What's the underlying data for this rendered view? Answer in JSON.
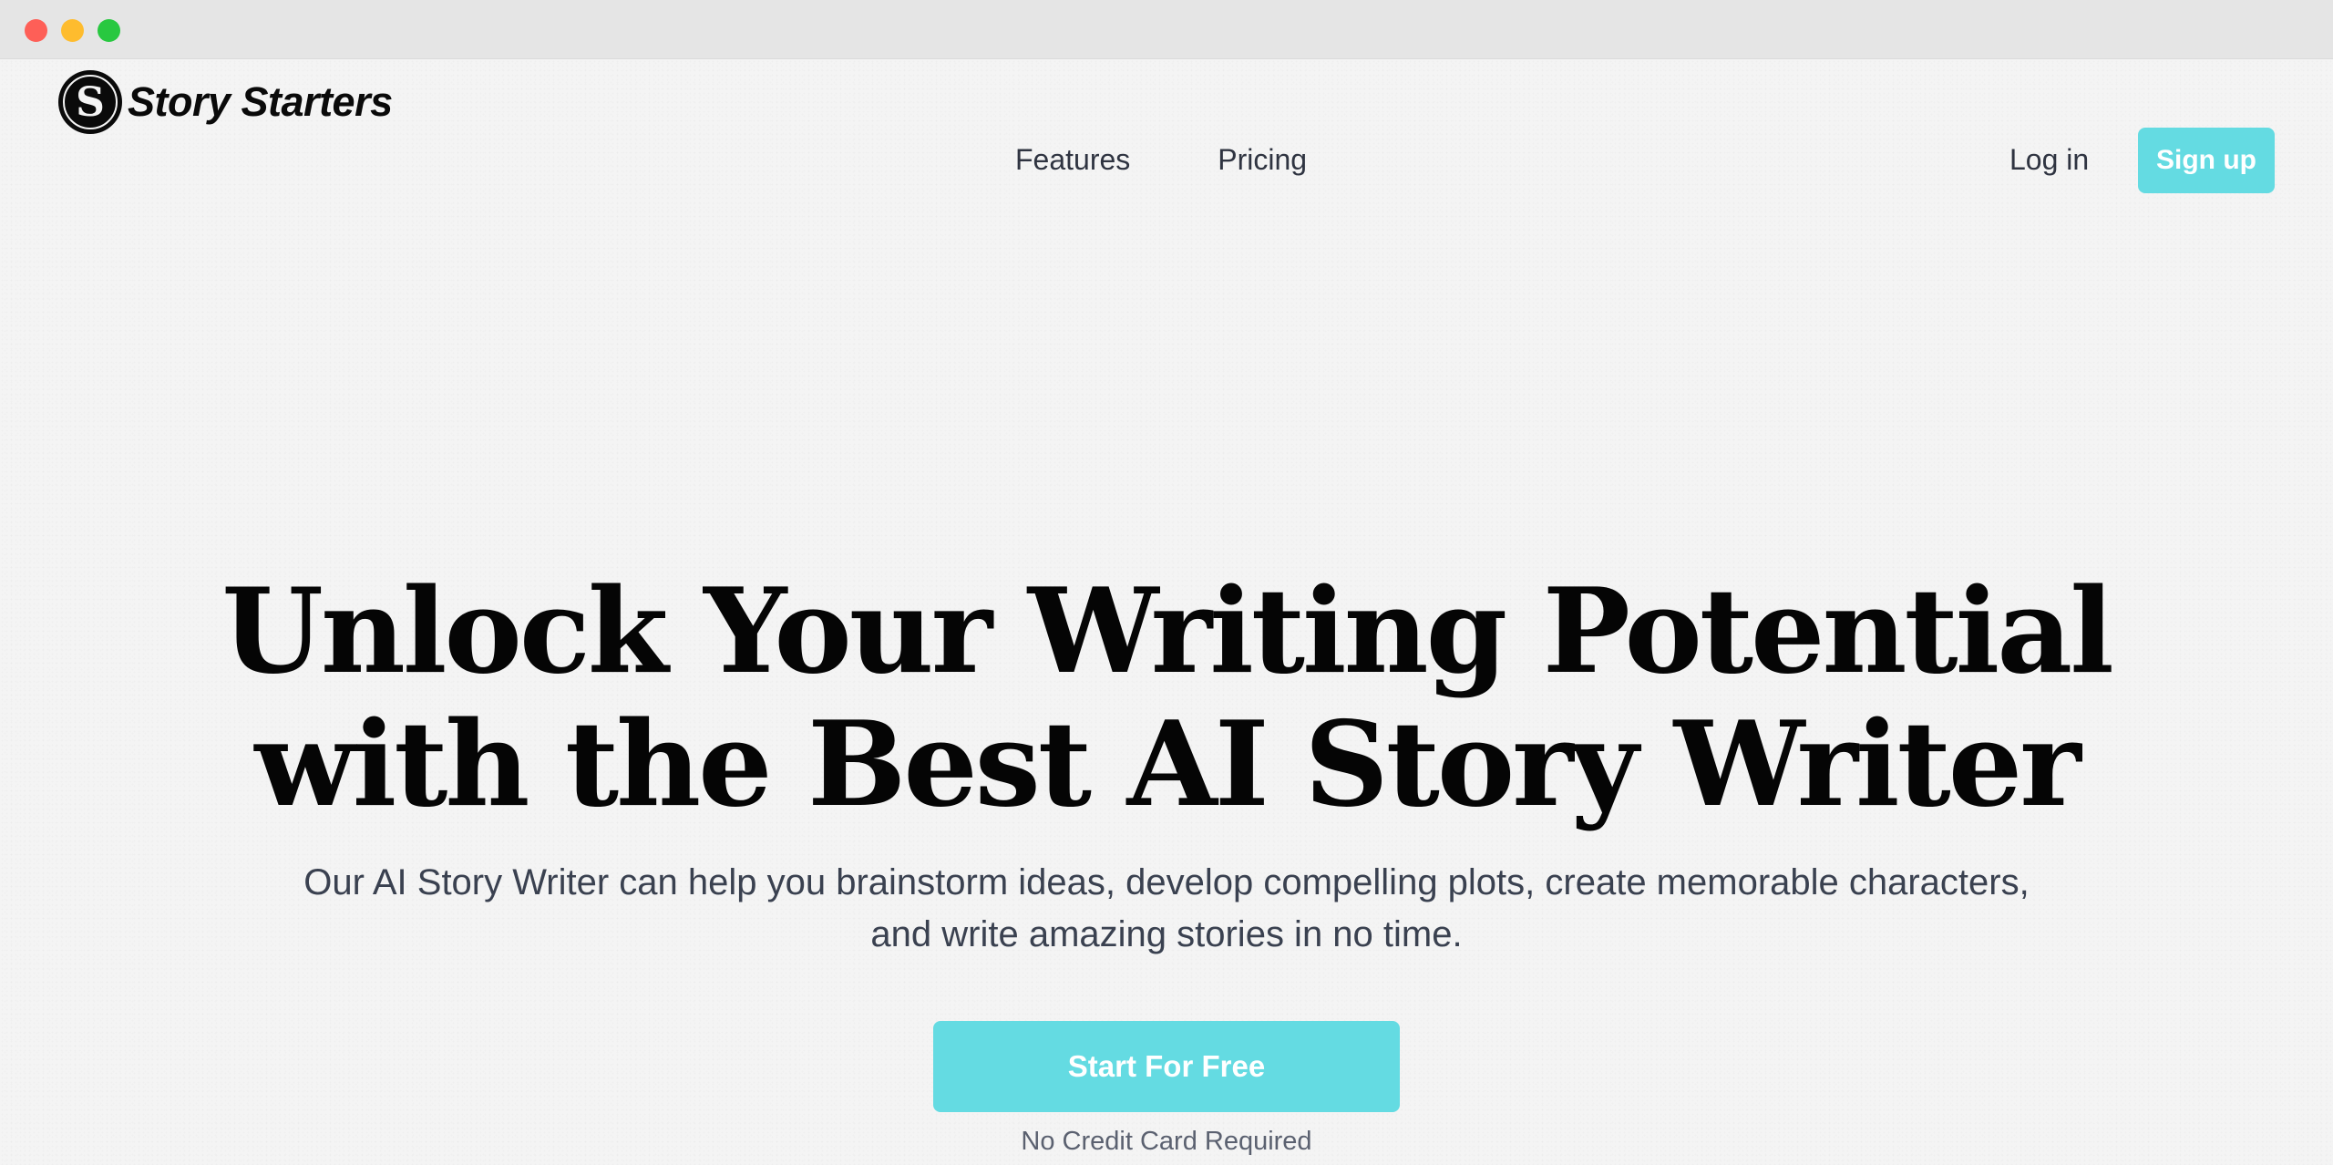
{
  "window": {
    "controls": [
      "close",
      "minimize",
      "zoom"
    ]
  },
  "brand": {
    "name": "Story Starters",
    "logo_icon": "s-monogram-icon",
    "logo_letter": "S"
  },
  "nav": {
    "links": [
      {
        "label": "Features"
      },
      {
        "label": "Pricing"
      }
    ],
    "login_label": "Log in",
    "signup_label": "Sign up"
  },
  "hero": {
    "title_line1": "Unlock Your Writing Potential",
    "title_line2": "with the Best AI Story Writer",
    "subtitle_line1": "Our AI Story Writer can help you brainstorm ideas, develop compelling plots, create memorable characters,",
    "subtitle_line2": "and write amazing stories in no time.",
    "cta_label": "Start For Free",
    "cta_note": "No Credit Card Required"
  },
  "colors": {
    "accent": "#64dbe2",
    "page_background": "#f4f4f4",
    "heading": "#050505",
    "body_text": "#3a4150"
  }
}
